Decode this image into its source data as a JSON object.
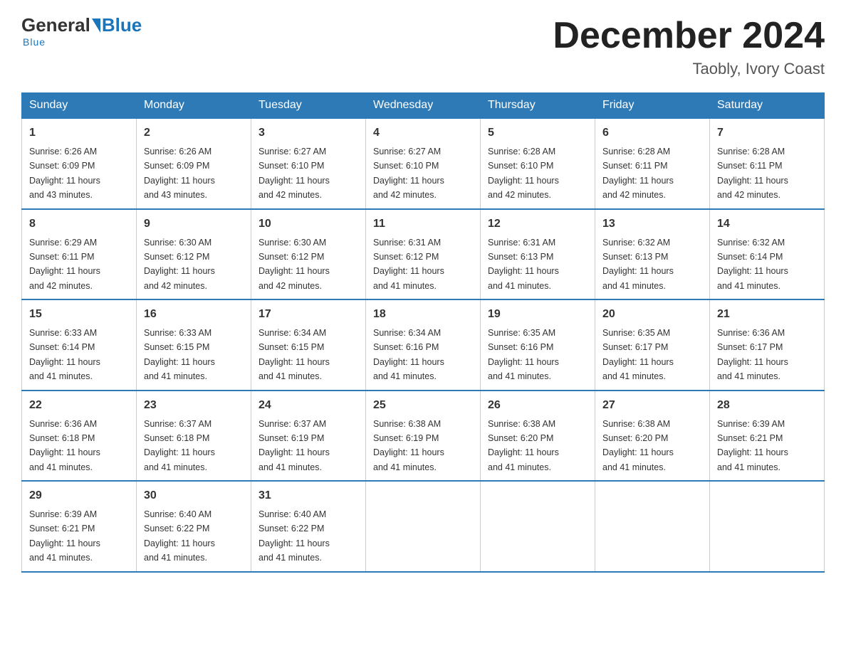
{
  "header": {
    "logo_general": "General",
    "logo_blue": "Blue",
    "month_year": "December 2024",
    "location": "Taobly, Ivory Coast"
  },
  "days_of_week": [
    "Sunday",
    "Monday",
    "Tuesday",
    "Wednesday",
    "Thursday",
    "Friday",
    "Saturday"
  ],
  "weeks": [
    [
      {
        "num": "1",
        "sunrise": "6:26 AM",
        "sunset": "6:09 PM",
        "daylight": "11 hours and 43 minutes."
      },
      {
        "num": "2",
        "sunrise": "6:26 AM",
        "sunset": "6:09 PM",
        "daylight": "11 hours and 43 minutes."
      },
      {
        "num": "3",
        "sunrise": "6:27 AM",
        "sunset": "6:10 PM",
        "daylight": "11 hours and 42 minutes."
      },
      {
        "num": "4",
        "sunrise": "6:27 AM",
        "sunset": "6:10 PM",
        "daylight": "11 hours and 42 minutes."
      },
      {
        "num": "5",
        "sunrise": "6:28 AM",
        "sunset": "6:10 PM",
        "daylight": "11 hours and 42 minutes."
      },
      {
        "num": "6",
        "sunrise": "6:28 AM",
        "sunset": "6:11 PM",
        "daylight": "11 hours and 42 minutes."
      },
      {
        "num": "7",
        "sunrise": "6:28 AM",
        "sunset": "6:11 PM",
        "daylight": "11 hours and 42 minutes."
      }
    ],
    [
      {
        "num": "8",
        "sunrise": "6:29 AM",
        "sunset": "6:11 PM",
        "daylight": "11 hours and 42 minutes."
      },
      {
        "num": "9",
        "sunrise": "6:30 AM",
        "sunset": "6:12 PM",
        "daylight": "11 hours and 42 minutes."
      },
      {
        "num": "10",
        "sunrise": "6:30 AM",
        "sunset": "6:12 PM",
        "daylight": "11 hours and 42 minutes."
      },
      {
        "num": "11",
        "sunrise": "6:31 AM",
        "sunset": "6:12 PM",
        "daylight": "11 hours and 41 minutes."
      },
      {
        "num": "12",
        "sunrise": "6:31 AM",
        "sunset": "6:13 PM",
        "daylight": "11 hours and 41 minutes."
      },
      {
        "num": "13",
        "sunrise": "6:32 AM",
        "sunset": "6:13 PM",
        "daylight": "11 hours and 41 minutes."
      },
      {
        "num": "14",
        "sunrise": "6:32 AM",
        "sunset": "6:14 PM",
        "daylight": "11 hours and 41 minutes."
      }
    ],
    [
      {
        "num": "15",
        "sunrise": "6:33 AM",
        "sunset": "6:14 PM",
        "daylight": "11 hours and 41 minutes."
      },
      {
        "num": "16",
        "sunrise": "6:33 AM",
        "sunset": "6:15 PM",
        "daylight": "11 hours and 41 minutes."
      },
      {
        "num": "17",
        "sunrise": "6:34 AM",
        "sunset": "6:15 PM",
        "daylight": "11 hours and 41 minutes."
      },
      {
        "num": "18",
        "sunrise": "6:34 AM",
        "sunset": "6:16 PM",
        "daylight": "11 hours and 41 minutes."
      },
      {
        "num": "19",
        "sunrise": "6:35 AM",
        "sunset": "6:16 PM",
        "daylight": "11 hours and 41 minutes."
      },
      {
        "num": "20",
        "sunrise": "6:35 AM",
        "sunset": "6:17 PM",
        "daylight": "11 hours and 41 minutes."
      },
      {
        "num": "21",
        "sunrise": "6:36 AM",
        "sunset": "6:17 PM",
        "daylight": "11 hours and 41 minutes."
      }
    ],
    [
      {
        "num": "22",
        "sunrise": "6:36 AM",
        "sunset": "6:18 PM",
        "daylight": "11 hours and 41 minutes."
      },
      {
        "num": "23",
        "sunrise": "6:37 AM",
        "sunset": "6:18 PM",
        "daylight": "11 hours and 41 minutes."
      },
      {
        "num": "24",
        "sunrise": "6:37 AM",
        "sunset": "6:19 PM",
        "daylight": "11 hours and 41 minutes."
      },
      {
        "num": "25",
        "sunrise": "6:38 AM",
        "sunset": "6:19 PM",
        "daylight": "11 hours and 41 minutes."
      },
      {
        "num": "26",
        "sunrise": "6:38 AM",
        "sunset": "6:20 PM",
        "daylight": "11 hours and 41 minutes."
      },
      {
        "num": "27",
        "sunrise": "6:38 AM",
        "sunset": "6:20 PM",
        "daylight": "11 hours and 41 minutes."
      },
      {
        "num": "28",
        "sunrise": "6:39 AM",
        "sunset": "6:21 PM",
        "daylight": "11 hours and 41 minutes."
      }
    ],
    [
      {
        "num": "29",
        "sunrise": "6:39 AM",
        "sunset": "6:21 PM",
        "daylight": "11 hours and 41 minutes."
      },
      {
        "num": "30",
        "sunrise": "6:40 AM",
        "sunset": "6:22 PM",
        "daylight": "11 hours and 41 minutes."
      },
      {
        "num": "31",
        "sunrise": "6:40 AM",
        "sunset": "6:22 PM",
        "daylight": "11 hours and 41 minutes."
      },
      null,
      null,
      null,
      null
    ]
  ],
  "labels": {
    "sunrise": "Sunrise:",
    "sunset": "Sunset:",
    "daylight": "Daylight:"
  }
}
